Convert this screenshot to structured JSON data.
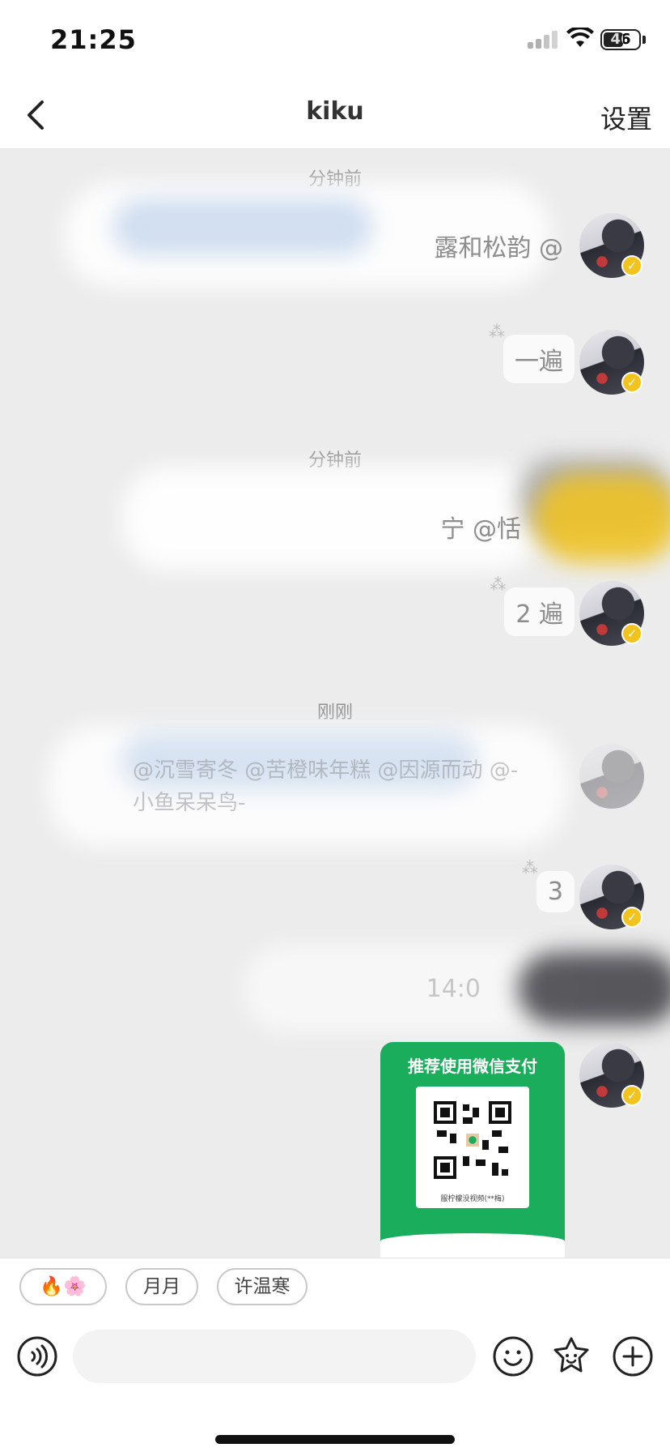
{
  "status_bar": {
    "time": "21:25",
    "battery": "46"
  },
  "nav": {
    "title": "kiku",
    "settings_label": "设置"
  },
  "chat": {
    "messages": [
      {
        "time_label": "分钟前",
        "text": "露和松韵 @"
      },
      {
        "text": "一遍"
      },
      {
        "time_label": "分钟前",
        "text": "宁 @恬"
      },
      {
        "text": "2 遍"
      },
      {
        "time_label": "刚刚",
        "text": "@沉雪寄冬 @苦橙味年糕 @因源而动 @-小鱼呆呆鸟-"
      },
      {
        "text": "3"
      },
      {
        "text": "14:0"
      }
    ],
    "payment_card": {
      "title": "推荐使用微信支付",
      "caption": "服柠檬没视频(**梅)"
    }
  },
  "quick_replies": [
    "🔥🌸",
    "月月",
    "许温寒"
  ],
  "icons": [
    "back-icon",
    "voice-icon",
    "emoji-icon",
    "sticker-icon",
    "plus-icon",
    "verified-badge-icon",
    "wifi-icon",
    "signal-icon",
    "battery-icon"
  ],
  "colors": {
    "accent_verified": "#f2c31c",
    "wechat_green": "#1aad5b",
    "background": "#ececec"
  }
}
